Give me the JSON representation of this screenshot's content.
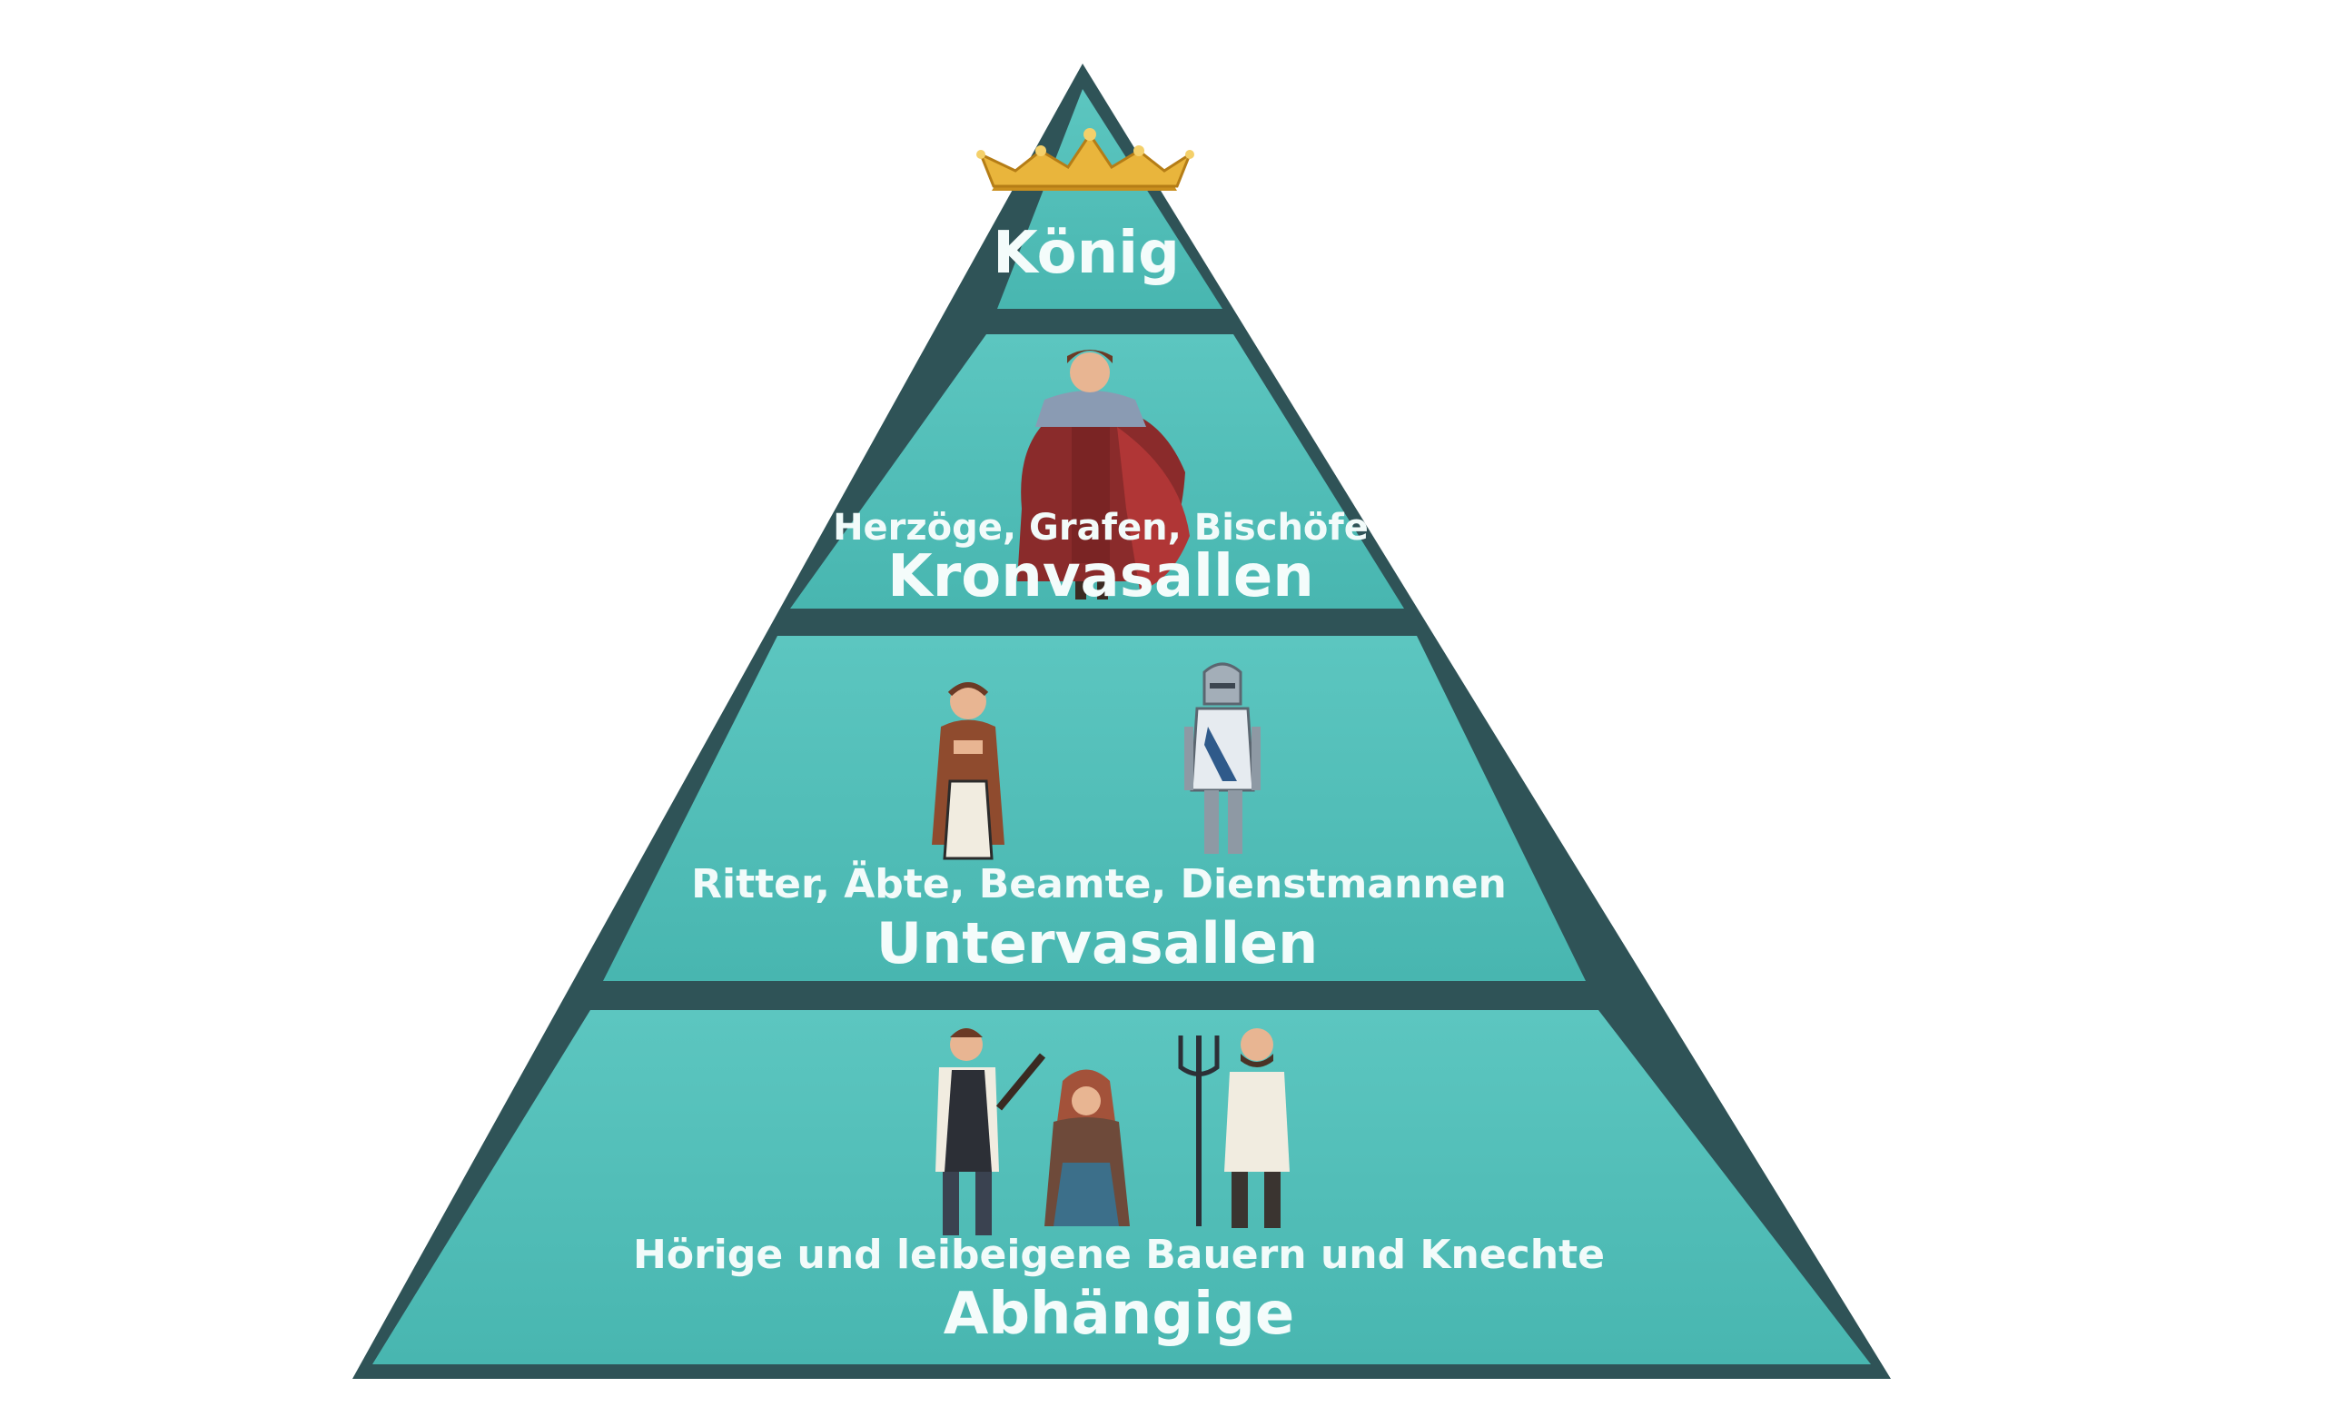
{
  "colors": {
    "outline": "#2f5357",
    "fill": "#4fbdb7",
    "fill_light": "#5cc7c1",
    "text": "#f4fcfb",
    "crown": "#e9b53c"
  },
  "tiers": [
    {
      "title": "König",
      "subtitle": "",
      "icons": [
        "crown-icon"
      ]
    },
    {
      "title": "Kronvasallen",
      "subtitle": "Herzöge, Grafen, Bischöfe",
      "icons": [
        "noble-figure-icon"
      ]
    },
    {
      "title": "Untervasallen",
      "subtitle": "Ritter, Äbte, Beamte, Dienstmannen",
      "icons": [
        "monk-figure-icon",
        "knight-figure-icon"
      ]
    },
    {
      "title": "Abhängige",
      "subtitle": "Hörige und leibeigene Bauern und Knechte",
      "icons": [
        "peasant-man-figure-icon",
        "peasant-woman-figure-icon",
        "farmer-with-pitchfork-icon"
      ]
    }
  ]
}
